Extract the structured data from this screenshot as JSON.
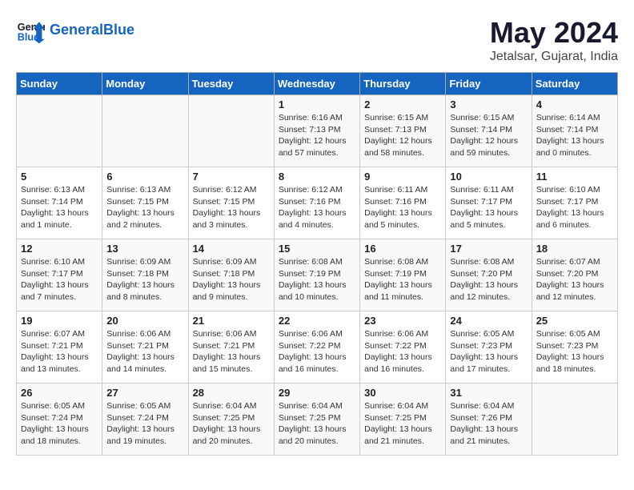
{
  "logo": {
    "text_general": "General",
    "text_blue": "Blue"
  },
  "title": "May 2024",
  "subtitle": "Jetalsar, Gujarat, India",
  "headers": [
    "Sunday",
    "Monday",
    "Tuesday",
    "Wednesday",
    "Thursday",
    "Friday",
    "Saturday"
  ],
  "weeks": [
    [
      {
        "day": "",
        "info": ""
      },
      {
        "day": "",
        "info": ""
      },
      {
        "day": "",
        "info": ""
      },
      {
        "day": "1",
        "info": "Sunrise: 6:16 AM\nSunset: 7:13 PM\nDaylight: 12 hours\nand 57 minutes."
      },
      {
        "day": "2",
        "info": "Sunrise: 6:15 AM\nSunset: 7:13 PM\nDaylight: 12 hours\nand 58 minutes."
      },
      {
        "day": "3",
        "info": "Sunrise: 6:15 AM\nSunset: 7:14 PM\nDaylight: 12 hours\nand 59 minutes."
      },
      {
        "day": "4",
        "info": "Sunrise: 6:14 AM\nSunset: 7:14 PM\nDaylight: 13 hours\nand 0 minutes."
      }
    ],
    [
      {
        "day": "5",
        "info": "Sunrise: 6:13 AM\nSunset: 7:14 PM\nDaylight: 13 hours\nand 1 minute."
      },
      {
        "day": "6",
        "info": "Sunrise: 6:13 AM\nSunset: 7:15 PM\nDaylight: 13 hours\nand 2 minutes."
      },
      {
        "day": "7",
        "info": "Sunrise: 6:12 AM\nSunset: 7:15 PM\nDaylight: 13 hours\nand 3 minutes."
      },
      {
        "day": "8",
        "info": "Sunrise: 6:12 AM\nSunset: 7:16 PM\nDaylight: 13 hours\nand 4 minutes."
      },
      {
        "day": "9",
        "info": "Sunrise: 6:11 AM\nSunset: 7:16 PM\nDaylight: 13 hours\nand 5 minutes."
      },
      {
        "day": "10",
        "info": "Sunrise: 6:11 AM\nSunset: 7:17 PM\nDaylight: 13 hours\nand 5 minutes."
      },
      {
        "day": "11",
        "info": "Sunrise: 6:10 AM\nSunset: 7:17 PM\nDaylight: 13 hours\nand 6 minutes."
      }
    ],
    [
      {
        "day": "12",
        "info": "Sunrise: 6:10 AM\nSunset: 7:17 PM\nDaylight: 13 hours\nand 7 minutes."
      },
      {
        "day": "13",
        "info": "Sunrise: 6:09 AM\nSunset: 7:18 PM\nDaylight: 13 hours\nand 8 minutes."
      },
      {
        "day": "14",
        "info": "Sunrise: 6:09 AM\nSunset: 7:18 PM\nDaylight: 13 hours\nand 9 minutes."
      },
      {
        "day": "15",
        "info": "Sunrise: 6:08 AM\nSunset: 7:19 PM\nDaylight: 13 hours\nand 10 minutes."
      },
      {
        "day": "16",
        "info": "Sunrise: 6:08 AM\nSunset: 7:19 PM\nDaylight: 13 hours\nand 11 minutes."
      },
      {
        "day": "17",
        "info": "Sunrise: 6:08 AM\nSunset: 7:20 PM\nDaylight: 13 hours\nand 12 minutes."
      },
      {
        "day": "18",
        "info": "Sunrise: 6:07 AM\nSunset: 7:20 PM\nDaylight: 13 hours\nand 12 minutes."
      }
    ],
    [
      {
        "day": "19",
        "info": "Sunrise: 6:07 AM\nSunset: 7:21 PM\nDaylight: 13 hours\nand 13 minutes."
      },
      {
        "day": "20",
        "info": "Sunrise: 6:06 AM\nSunset: 7:21 PM\nDaylight: 13 hours\nand 14 minutes."
      },
      {
        "day": "21",
        "info": "Sunrise: 6:06 AM\nSunset: 7:21 PM\nDaylight: 13 hours\nand 15 minutes."
      },
      {
        "day": "22",
        "info": "Sunrise: 6:06 AM\nSunset: 7:22 PM\nDaylight: 13 hours\nand 16 minutes."
      },
      {
        "day": "23",
        "info": "Sunrise: 6:06 AM\nSunset: 7:22 PM\nDaylight: 13 hours\nand 16 minutes."
      },
      {
        "day": "24",
        "info": "Sunrise: 6:05 AM\nSunset: 7:23 PM\nDaylight: 13 hours\nand 17 minutes."
      },
      {
        "day": "25",
        "info": "Sunrise: 6:05 AM\nSunset: 7:23 PM\nDaylight: 13 hours\nand 18 minutes."
      }
    ],
    [
      {
        "day": "26",
        "info": "Sunrise: 6:05 AM\nSunset: 7:24 PM\nDaylight: 13 hours\nand 18 minutes."
      },
      {
        "day": "27",
        "info": "Sunrise: 6:05 AM\nSunset: 7:24 PM\nDaylight: 13 hours\nand 19 minutes."
      },
      {
        "day": "28",
        "info": "Sunrise: 6:04 AM\nSunset: 7:25 PM\nDaylight: 13 hours\nand 20 minutes."
      },
      {
        "day": "29",
        "info": "Sunrise: 6:04 AM\nSunset: 7:25 PM\nDaylight: 13 hours\nand 20 minutes."
      },
      {
        "day": "30",
        "info": "Sunrise: 6:04 AM\nSunset: 7:25 PM\nDaylight: 13 hours\nand 21 minutes."
      },
      {
        "day": "31",
        "info": "Sunrise: 6:04 AM\nSunset: 7:26 PM\nDaylight: 13 hours\nand 21 minutes."
      },
      {
        "day": "",
        "info": ""
      }
    ]
  ]
}
